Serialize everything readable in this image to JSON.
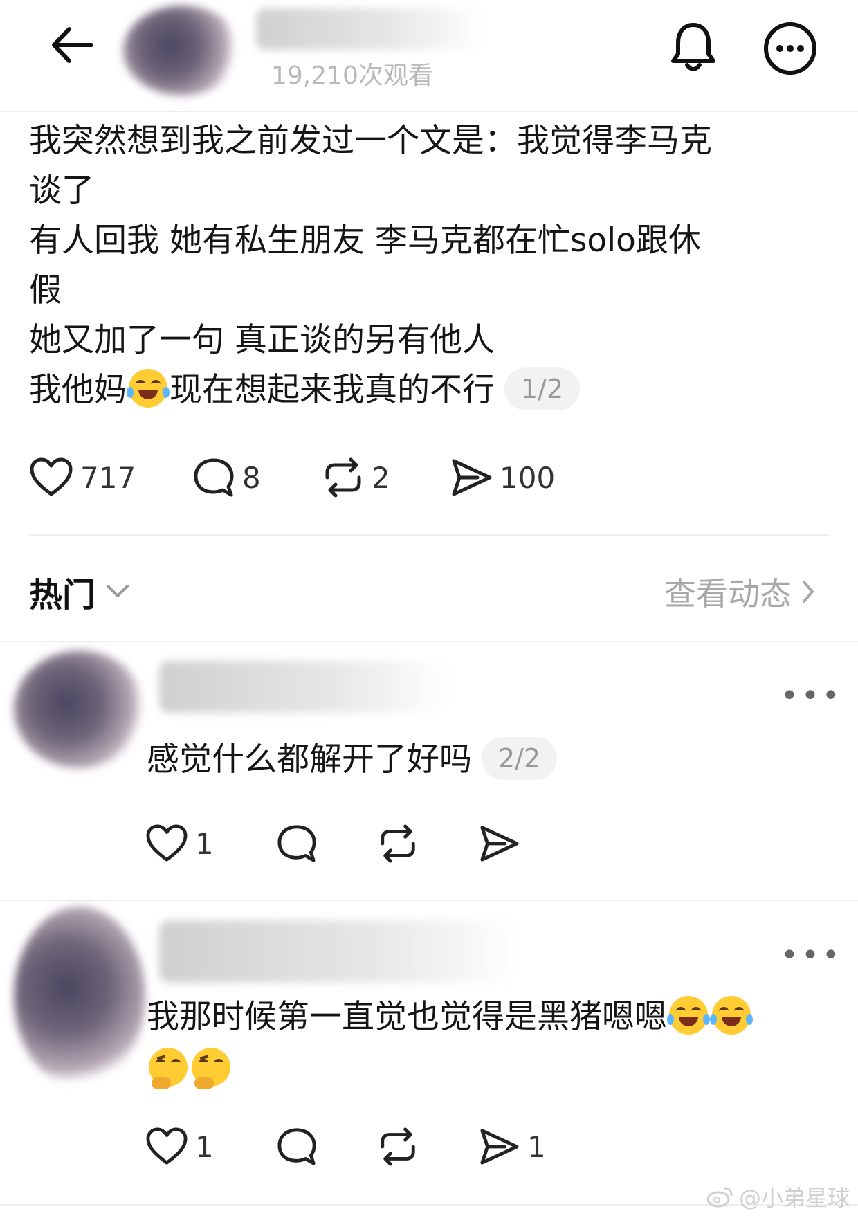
{
  "header": {
    "views": "19,210次观看",
    "back_icon": "arrow-left-icon",
    "bell_icon": "bell-icon",
    "more_icon": "more-circle-icon"
  },
  "post": {
    "lines": [
      "我突然想到我之前发过一个文是：我觉得李马克",
      "谈了",
      "有人回我 她有私生朋友 李马克都在忙solo跟休",
      "假",
      "她又加了一句 真正谈的另有他人"
    ],
    "last_line_a": "我他妈",
    "last_line_b": "现在想起来我真的不行",
    "page_indicator": "1/2",
    "stats": {
      "likes": "717",
      "comments": "8",
      "reposts": "2",
      "shares": "100"
    }
  },
  "section": {
    "title": "热门",
    "view_activity": "查看动态"
  },
  "comments": [
    {
      "text": "感觉什么都解开了好吗",
      "page_indicator": "2/2",
      "likes": "1"
    },
    {
      "text": "我那时候第一直觉也觉得是黑猪嗯嗯",
      "likes": "1",
      "shares": "1"
    }
  ],
  "watermark": "@小弟星球",
  "colors": {
    "text": "#151515",
    "muted": "#a8a8a8",
    "divider": "#eeeeee",
    "pill_bg": "#f2f2f2"
  }
}
